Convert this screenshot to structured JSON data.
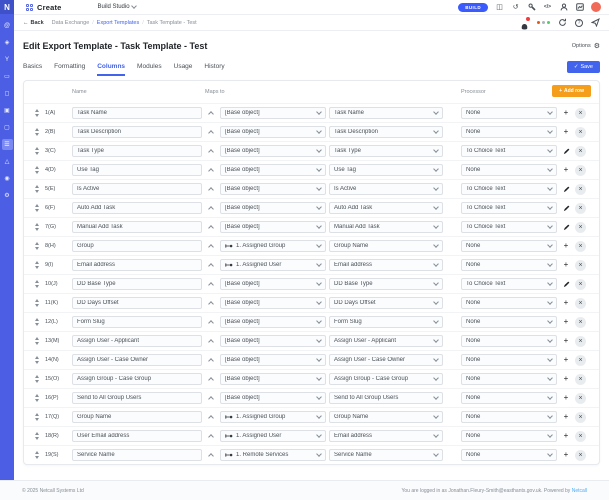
{
  "topbar": {
    "brand": "Create",
    "workspace": "Build Studio",
    "build_button": "BUILD",
    "icons": [
      "panel-icon",
      "history-icon",
      "wrench-icon",
      "code-icon",
      "user-icon",
      "chart-icon"
    ],
    "code_icon_text": "</>"
  },
  "sidebar": {
    "logo": "N",
    "items": [
      {
        "name": "account-icon",
        "glyph": "@",
        "active": false
      },
      {
        "name": "security-icon",
        "glyph": "◈",
        "active": false
      },
      {
        "name": "workflow-icon",
        "glyph": "Y",
        "active": false
      },
      {
        "name": "screens-icon",
        "glyph": "▭",
        "active": false
      },
      {
        "name": "messages-icon",
        "glyph": "◻",
        "active": false
      },
      {
        "name": "media-icon",
        "glyph": "▣",
        "active": false
      },
      {
        "name": "modules-icon",
        "glyph": "▢",
        "active": false
      },
      {
        "name": "studio-icon",
        "glyph": "☰",
        "active": true
      },
      {
        "name": "labs-icon",
        "glyph": "△",
        "active": false
      },
      {
        "name": "places-icon",
        "glyph": "◉",
        "active": false
      },
      {
        "name": "settings-icon",
        "glyph": "⚙",
        "active": false
      }
    ]
  },
  "breadcrumb": {
    "back_label": "Back",
    "back_arrow": "←",
    "items": [
      "Data Exchange",
      "Export Templates",
      "Task Template - Test"
    ],
    "link_index": 1,
    "separator": "/",
    "status_dot_colors": [
      "#e8590c",
      "#adb5bd",
      "#51cf66"
    ]
  },
  "page": {
    "title": "Edit Export Template - Task Template - Test",
    "options_label": "Options",
    "gear_glyph": "⚙"
  },
  "tabs": {
    "items": [
      "Basics",
      "Formatting",
      "Columns",
      "Modules",
      "Usage",
      "History"
    ],
    "active": "Columns",
    "save_label": "Save",
    "save_check_glyph": "✓"
  },
  "table": {
    "headers": {
      "name": "Name",
      "maps_to": "Maps to",
      "processor": "Processor"
    },
    "add_row_label": "Add row",
    "add_row_plus_glyph": "+",
    "row_action_add_glyph": "+",
    "row_close_glyph": "×",
    "rows": [
      {
        "id": "1(A)",
        "name": "Task Name",
        "maps_to": "[Base object]",
        "linked": false,
        "field": "Task Name",
        "processor": "None",
        "action": "add"
      },
      {
        "id": "2(B)",
        "name": "Task Description",
        "maps_to": "[Base object]",
        "linked": false,
        "field": "Task Description",
        "processor": "None",
        "action": "add"
      },
      {
        "id": "3(C)",
        "name": "Task Type",
        "maps_to": "[Base object]",
        "linked": false,
        "field": "Task Type",
        "processor": "To Choice Text",
        "action": "edit"
      },
      {
        "id": "4(D)",
        "name": "Use Tag",
        "maps_to": "[Base object]",
        "linked": false,
        "field": "Use Tag",
        "processor": "None",
        "action": "add"
      },
      {
        "id": "5(E)",
        "name": "Is Active",
        "maps_to": "[Base object]",
        "linked": false,
        "field": "Is Active",
        "processor": "To Choice Text",
        "action": "edit"
      },
      {
        "id": "6(F)",
        "name": "Auto Add Task",
        "maps_to": "[Base object]",
        "linked": false,
        "field": "Auto Add Task",
        "processor": "To Choice Text",
        "action": "edit"
      },
      {
        "id": "7(G)",
        "name": "Manual Add Task",
        "maps_to": "[Base object]",
        "linked": false,
        "field": "Manual Add Task",
        "processor": "To Choice Text",
        "action": "edit"
      },
      {
        "id": "8(H)",
        "name": "Group",
        "maps_to": "1. Assigned Group",
        "linked": true,
        "field": "Group Name",
        "processor": "None",
        "action": "add"
      },
      {
        "id": "9(I)",
        "name": "Email address",
        "maps_to": "1. Assigned User",
        "linked": true,
        "field": "Email address",
        "processor": "None",
        "action": "add"
      },
      {
        "id": "10(J)",
        "name": "DD Base Type",
        "maps_to": "[Base object]",
        "linked": false,
        "field": "DD Base Type",
        "processor": "To Choice Text",
        "action": "edit"
      },
      {
        "id": "11(K)",
        "name": "DD Days Offset",
        "maps_to": "[Base object]",
        "linked": false,
        "field": "DD Days Offset",
        "processor": "None",
        "action": "add"
      },
      {
        "id": "12(L)",
        "name": "Form Slug",
        "maps_to": "[Base object]",
        "linked": false,
        "field": "Form Slug",
        "processor": "None",
        "action": "add"
      },
      {
        "id": "13(M)",
        "name": "Assign User - Applicant",
        "maps_to": "[Base object]",
        "linked": false,
        "field": "Assign User - Applicant",
        "processor": "None",
        "action": "add"
      },
      {
        "id": "14(N)",
        "name": "Assign User - Case Owner",
        "maps_to": "[Base object]",
        "linked": false,
        "field": "Assign User - Case Owner",
        "processor": "None",
        "action": "add"
      },
      {
        "id": "15(O)",
        "name": "Assign Group - Case Group",
        "maps_to": "[Base object]",
        "linked": false,
        "field": "Assign Group - Case Group",
        "processor": "None",
        "action": "add"
      },
      {
        "id": "16(P)",
        "name": "Send to All Group Users",
        "maps_to": "[Base object]",
        "linked": false,
        "field": "Send to All Group Users",
        "processor": "None",
        "action": "add"
      },
      {
        "id": "17(Q)",
        "name": "Group Name",
        "maps_to": "1. Assigned Group",
        "linked": true,
        "field": "Group Name",
        "processor": "None",
        "action": "add"
      },
      {
        "id": "18(R)",
        "name": "User Email address",
        "maps_to": "1. Assigned User",
        "linked": true,
        "field": "Email address",
        "processor": "None",
        "action": "add"
      },
      {
        "id": "19(S)",
        "name": "Service Name",
        "maps_to": "1. Remote Services",
        "linked": true,
        "field": "Service Name",
        "processor": "None",
        "action": "add"
      }
    ]
  },
  "footer": {
    "left": "© 2025 Netcall Systems Ltd",
    "right_prefix": "You are logged in as Jonathan.Fleury-Smith@easthants.gov.uk. Powered by ",
    "right_link": "Netcall"
  }
}
